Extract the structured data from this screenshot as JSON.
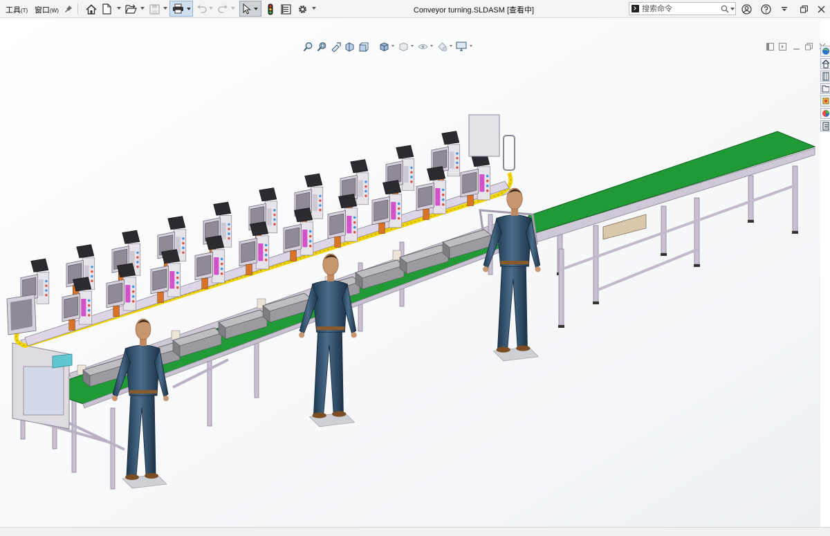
{
  "menu": {
    "tools_label": "工具",
    "tools_key": "(T)",
    "window_label": "窗口",
    "window_key": "(W)"
  },
  "document": {
    "title": "Conveyor turning.SLDASM [查看中]"
  },
  "search": {
    "placeholder": "搜索命令"
  },
  "colors": {
    "belt_green": "#1f9a34",
    "rail_yellow": "#f0d400",
    "frame_lavender": "#c9c0d3",
    "operator_navy": "#2d4a63",
    "accent_magenta": "#d040c8",
    "accent_orange": "#d8742a",
    "window_bg": "#f4f4f4"
  },
  "icons": {
    "toolbar": [
      "pin-icon",
      "home-icon",
      "new-document-icon",
      "open-folder-icon",
      "save-icon",
      "print-icon",
      "undo-icon",
      "redo-icon",
      "select-arrow-icon",
      "traffic-light-icon",
      "file-properties-icon",
      "gear-icon"
    ],
    "window_controls": [
      "user-icon",
      "help-icon",
      "options-icon",
      "restore-icon",
      "close-icon"
    ],
    "heads_up": [
      "zoom-to-fit-icon",
      "zoom-area-icon",
      "previous-view-icon",
      "section-view-icon",
      "dynamic-annotation-icon",
      "view-orientation-icon",
      "display-style-icon",
      "hide-show-icon",
      "edit-appearance-icon",
      "apply-scene-icon",
      "view-settings-icon"
    ],
    "task_pane": [
      "resources-icon",
      "design-library-icon",
      "file-explorer-icon",
      "view-palette-icon",
      "appearances-icon",
      "custom-properties-icon"
    ]
  }
}
